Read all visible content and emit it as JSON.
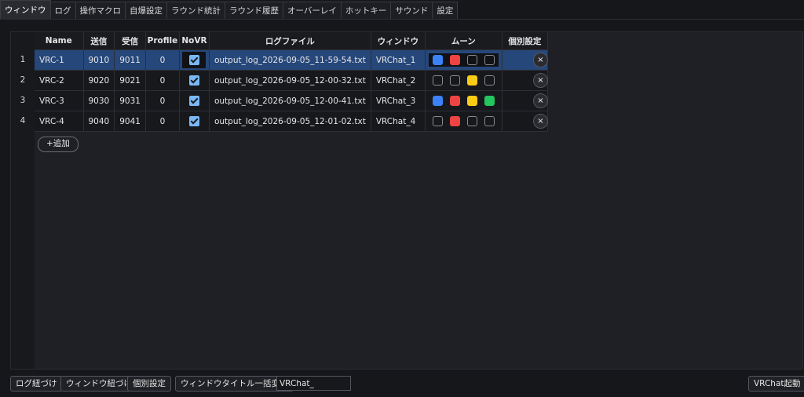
{
  "tabs": [
    {
      "label": "ウィンドウ",
      "active": true
    },
    {
      "label": "ログ"
    },
    {
      "label": "操作マクロ"
    },
    {
      "label": "自爆設定"
    },
    {
      "label": "ラウンド統計"
    },
    {
      "label": "ラウンド履歴"
    },
    {
      "label": "オーバーレイ"
    },
    {
      "label": "ホットキー"
    },
    {
      "label": "サウンド"
    },
    {
      "label": "設定"
    }
  ],
  "table": {
    "headers": [
      "Name",
      "送信",
      "受信",
      "Profile",
      "NoVR",
      "ログファイル",
      "ウィンドウ",
      "ムーン",
      "個別設定"
    ],
    "rows": [
      {
        "num": "1",
        "name": "VRC-1",
        "send": "9010",
        "recv": "9011",
        "profile": "0",
        "novr": true,
        "log": "output_log_2026-09-05_11-59-54.txt",
        "window": "VRChat_1",
        "moons": [
          true,
          true,
          false,
          false
        ],
        "selected": true
      },
      {
        "num": "2",
        "name": "VRC-2",
        "send": "9020",
        "recv": "9021",
        "profile": "0",
        "novr": true,
        "log": "output_log_2026-09-05_12-00-32.txt",
        "window": "VRChat_2",
        "moons": [
          false,
          false,
          true,
          false
        ]
      },
      {
        "num": "3",
        "name": "VRC-3",
        "send": "9030",
        "recv": "9031",
        "profile": "0",
        "novr": true,
        "log": "output_log_2026-09-05_12-00-41.txt",
        "window": "VRChat_3",
        "moons": [
          true,
          true,
          true,
          true
        ]
      },
      {
        "num": "4",
        "name": "VRC-4",
        "send": "9040",
        "recv": "9041",
        "profile": "0",
        "novr": true,
        "log": "output_log_2026-09-05_12-01-02.txt",
        "window": "VRChat_4",
        "moons": [
          false,
          true,
          false,
          false
        ]
      }
    ],
    "moon_colors": [
      "#3b82f6",
      "#ef4444",
      "#facc15",
      "#22c55e"
    ],
    "delete_glyph": "×",
    "add_label": "+追加"
  },
  "bottom": {
    "log_link": "ログ紐づけ",
    "window_link": "ウィンドウ紐づけ",
    "individual": "個別設定",
    "rename_all": "ウィンドウタイトル一括変更",
    "title_input_value": "VRChat_",
    "launch": "VRChat起動"
  },
  "colors": {
    "selection": "#26477a",
    "checkbox": "#7ab8f5"
  }
}
